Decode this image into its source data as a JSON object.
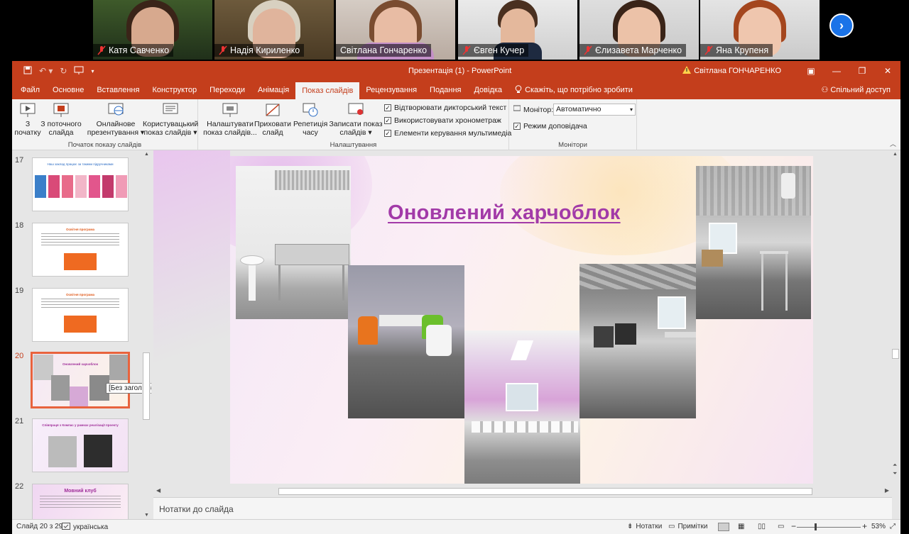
{
  "meeting": {
    "participants": [
      {
        "name": "Катя Савченко",
        "muted": true
      },
      {
        "name": "Надія Кириленко",
        "muted": true
      },
      {
        "name": "Світлана Гончаренко",
        "muted": false,
        "active": true
      },
      {
        "name": "Євген Кучер",
        "muted": true
      },
      {
        "name": "Єлизавета Марченко",
        "muted": true
      },
      {
        "name": "Яна Крупеня",
        "muted": true
      }
    ],
    "next_icon": "chevron-right-icon"
  },
  "window": {
    "title": "Презентація (1)  -  PowerPoint",
    "user": "Світлана ГОНЧАРЕНКО",
    "share": "Спільний доступ"
  },
  "tabs": [
    "Файл",
    "Основне",
    "Вставлення",
    "Конструктор",
    "Переходи",
    "Анімація",
    "Показ слайдів",
    "Рецензування",
    "Подання",
    "Довідка"
  ],
  "active_tab": "Показ слайдів",
  "tell_me": "Скажіть, що потрібно зробити",
  "ribbon": {
    "group1": {
      "label": "Початок показу слайдів",
      "b1_l1": "З",
      "b1_l2": "початку",
      "b2_l1": "З поточного",
      "b2_l2": "слайда",
      "b3_l1": "Онлайнове",
      "b3_l2": "презентування ▾",
      "b4_l1": "Користувацький",
      "b4_l2": "показ слайдів ▾"
    },
    "group2": {
      "label": "Налаштування",
      "b1_l1": "Налаштувати",
      "b1_l2": "показ слайдів...",
      "b2_l1": "Приховати",
      "b2_l2": "слайд",
      "b3_l1": "Репетиція",
      "b3_l2": "часу",
      "b4_l1": "Записати показ",
      "b4_l2": "слайдів ▾",
      "c1": "Відтворювати дикторський текст",
      "c2": "Використовувати хронометраж",
      "c3": "Елементи керування мультимедіа"
    },
    "group3": {
      "label": "Монітори",
      "monitor_label": "Монітор:",
      "monitor_value": "Автоматично",
      "presenter_view": "Режим доповідача"
    }
  },
  "thumbnails": [
    {
      "num": "17",
      "title": "Наш заклад працює за такими підручниками"
    },
    {
      "num": "18",
      "title": "Освітня програма"
    },
    {
      "num": "19",
      "title": "Освітня програма"
    },
    {
      "num": "20",
      "title": "Оновлений харчоблок"
    },
    {
      "num": "21",
      "title": "Співпраця з Компас у рамках реалізації проекту"
    },
    {
      "num": "22",
      "title": "Мовний клуб"
    }
  ],
  "tooltip": "[Без заголовка]",
  "slide": {
    "title": "Оновлений харчоблок"
  },
  "notes_placeholder": "Нотатки до слайда",
  "status": {
    "slide_info": "Слайд 20 з 29",
    "language": "українська",
    "notes": "Нотатки",
    "comments": "Примітки",
    "zoom": "53%"
  },
  "colors": {
    "accent": "#c43e1c",
    "title": "#a23aa8",
    "active_speaker": "#23d96b"
  }
}
